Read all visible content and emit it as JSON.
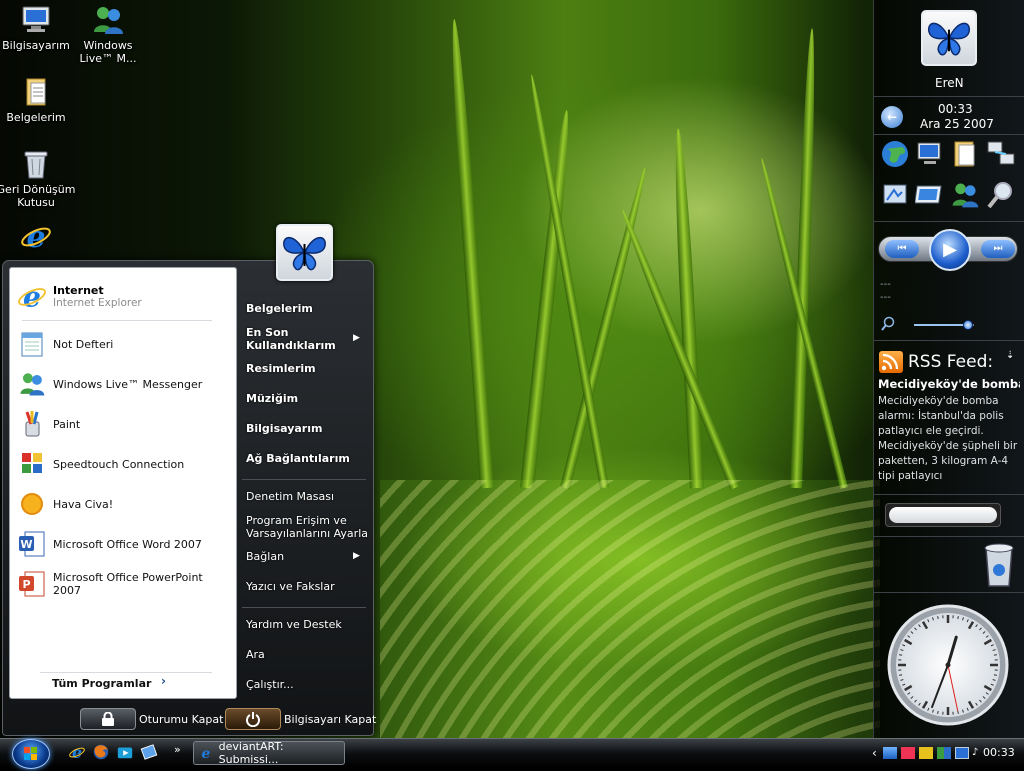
{
  "desktop": {
    "icons": [
      {
        "label": "Bilgisayarım",
        "icon": "computer-icon"
      },
      {
        "label": "Windows Live™ M...",
        "icon": "messenger-icon"
      },
      {
        "label": "Belgelerim",
        "icon": "documents-icon"
      },
      {
        "label": "Geri Dönüşüm Kutusu",
        "icon": "recycle-bin-icon"
      },
      {
        "label": "",
        "icon": "internet-explorer-icon"
      }
    ]
  },
  "start_menu": {
    "pinned": {
      "title": "Internet",
      "subtitle": "Internet Explorer"
    },
    "programs": [
      {
        "label": "Not Defteri",
        "icon": "notepad-icon"
      },
      {
        "label": "Windows Live™ Messenger",
        "icon": "messenger-icon"
      },
      {
        "label": "Paint",
        "icon": "paint-icon"
      },
      {
        "label": "Speedtouch Connection",
        "icon": "speedtouch-icon"
      },
      {
        "label": "Hava Civa!",
        "icon": "weather-icon"
      },
      {
        "label": "Microsoft Office Word 2007",
        "icon": "word-icon"
      },
      {
        "label": "Microsoft Office PowerPoint 2007",
        "icon": "powerpoint-icon"
      }
    ],
    "all_programs": "Tüm Programlar",
    "right": {
      "documents": "Belgelerim",
      "recent_1": "En Son",
      "recent_2": "Kullandıklarım",
      "pictures": "Resimlerim",
      "music": "Müziğim",
      "computer": "Bilgisayarım",
      "network": "Ağ Bağlantılarım",
      "control_panel": "Denetim Masası",
      "program_access_1": "Program Erişim ve",
      "program_access_2": "Varsayılanlarını Ayarla",
      "connect": "Bağlan",
      "printers": "Yazıcı ve Fakslar",
      "help": "Yardım ve Destek",
      "search": "Ara",
      "run": "Çalıştır..."
    },
    "log_off": "Oturumu Kapat",
    "shut_down": "Bilgisayarı Kapat"
  },
  "taskbar": {
    "task_label": "deviantART: Submissi...",
    "overflow": "»",
    "clock": "00:33"
  },
  "sidebar": {
    "user": "EreN",
    "time": "00:33",
    "date": "Ara 25 2007",
    "media_line1": "---",
    "media_line2": "---",
    "volume_percent": 90,
    "rss": {
      "title": "RSS Feed:",
      "headline": "Mecidiyeköy'de bomba",
      "body": "Mecidiyeköy'de bomba alarmı: İstanbul'da polis patlayıcı ele geçirdi. Mecidiyeköy'de şüpheli bir paketten, 3 kilogram A-4 tipi patlayıcı"
    },
    "clock": {
      "hour": 0,
      "minute": 33,
      "second": 28
    }
  }
}
